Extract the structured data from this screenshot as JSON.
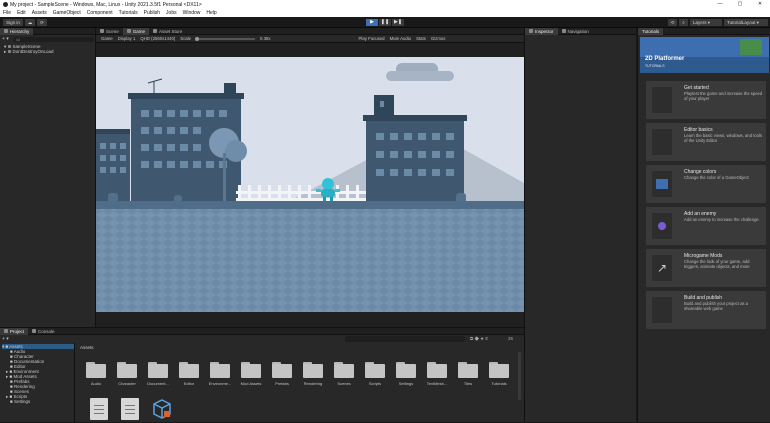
{
  "window": {
    "title": "My project - SampleScene - Windows, Mac, Linux - Unity 2021.3.5f1 Personal <DX11>",
    "controls": [
      "—",
      "▢",
      "✕"
    ]
  },
  "menu": [
    "File",
    "Edit",
    "Assets",
    "GameObject",
    "Component",
    "Tutorials",
    "Publish",
    "Jobs",
    "Window",
    "Help"
  ],
  "toolbar": {
    "sign_in": "Sign in",
    "cloud_icon": "cloud-icon",
    "layers": "Layers",
    "layout": "TutorialLayout"
  },
  "hierarchy": {
    "tab": "Hierarchy",
    "search_placeholder": "All",
    "rows": [
      "SampleScene",
      "DontDestroyOnLoad"
    ]
  },
  "center_tabs": [
    "Scene",
    "Game",
    "Asset Store"
  ],
  "gamebar": {
    "mode": "Game",
    "display": "Display 1",
    "resolution": "QHD (2560x1440)",
    "scale_label": "Scale",
    "scale_value": "0.38x",
    "play_focused": "Play Focused",
    "mute": "Mute Audio",
    "stats": "Stats",
    "gizmos": "Gizmos"
  },
  "right_tabs": [
    "Inspector",
    "Navigation"
  ],
  "tutorials": {
    "tab": "Tutorials",
    "banner_title": "2D Platformer",
    "banner_sub": "TUTORIALS",
    "cards": [
      {
        "title": "Get started",
        "desc": "Playtest the game and increase the speed of your player"
      },
      {
        "title": "Editor basics",
        "desc": "Learn the basic views, windows, and tools of the Unity Editor"
      },
      {
        "title": "Change colors",
        "desc": "Change the color of a GameObject"
      },
      {
        "title": "Add an enemy",
        "desc": "Add an enemy to increase the challenge"
      },
      {
        "title": "Microgame Mods",
        "desc": "Change the look of your game, add triggers, animate objects, and more"
      },
      {
        "title": "Build and publish",
        "desc": "Build and publish your project as a shareable web game"
      }
    ]
  },
  "project": {
    "tabs": [
      "Project",
      "Console"
    ],
    "breadcrumb": "Assets",
    "hidden_count": "25",
    "tree": [
      "Assets",
      "Audio",
      "Character",
      "Documentation",
      "Editor",
      "Environment",
      "Mod Assets",
      "Prefabs",
      "Rendering",
      "Scenes",
      "Scripts",
      "Settings"
    ],
    "folders": [
      "Audio",
      "Character",
      "Document...",
      "Editor",
      "Environme...",
      "Mod Assets",
      "Prefabs",
      "Rendering",
      "Scenes",
      "Scripts",
      "Settings",
      "TextMesh...",
      "Tiles",
      "Tutorials"
    ]
  }
}
